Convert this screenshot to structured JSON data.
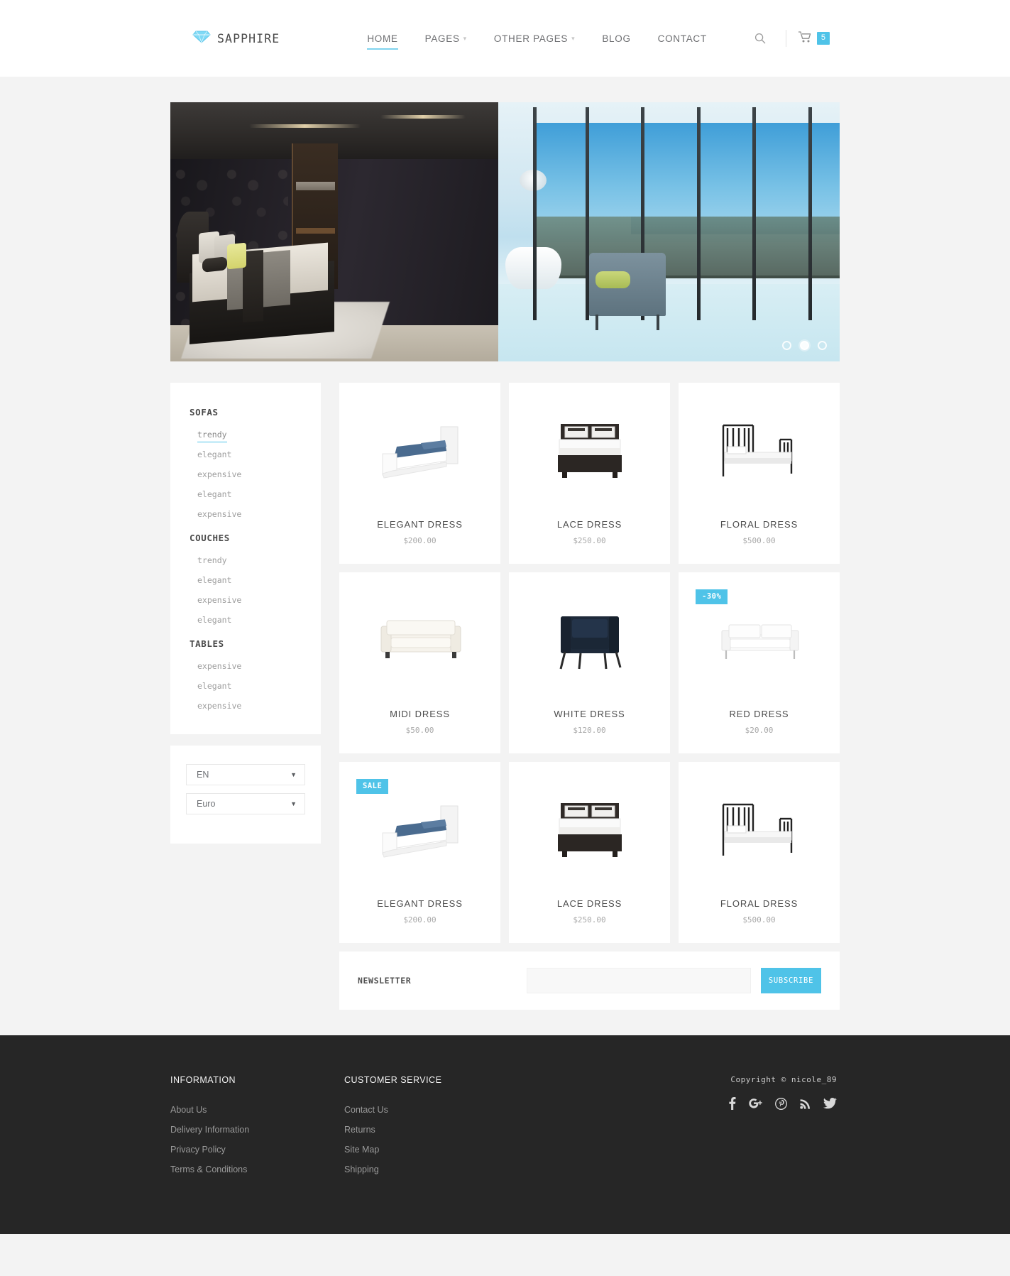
{
  "brand": {
    "name": "SAPPHIRE",
    "logo_icon": "diamond-icon",
    "accent": "#4fc3e8"
  },
  "nav": {
    "items": [
      {
        "label": "HOME",
        "active": true,
        "has_dropdown": false
      },
      {
        "label": "PAGES",
        "active": false,
        "has_dropdown": true
      },
      {
        "label": "OTHER PAGES",
        "active": false,
        "has_dropdown": true
      },
      {
        "label": "BLOG",
        "active": false,
        "has_dropdown": false
      },
      {
        "label": "CONTACT",
        "active": false,
        "has_dropdown": false
      }
    ]
  },
  "tools": {
    "search_icon": "search-icon",
    "cart_icon": "shopping-cart-icon",
    "cart_count": "5"
  },
  "hero": {
    "alt": "luxury bedroom with floor to ceiling windows and city view",
    "dots": [
      {
        "active": false
      },
      {
        "active": true
      },
      {
        "active": false
      }
    ]
  },
  "sidebar": {
    "groups": [
      {
        "title": "SOFAS",
        "links": [
          {
            "label": "trendy",
            "active": true
          },
          {
            "label": "elegant",
            "active": false
          },
          {
            "label": "expensive",
            "active": false
          },
          {
            "label": "elegant",
            "active": false
          },
          {
            "label": "expensive",
            "active": false
          }
        ]
      },
      {
        "title": "COUCHES",
        "links": [
          {
            "label": "trendy",
            "active": false
          },
          {
            "label": "elegant",
            "active": false
          },
          {
            "label": "expensive",
            "active": false
          },
          {
            "label": "elegant",
            "active": false
          }
        ]
      },
      {
        "title": "TABLES",
        "links": [
          {
            "label": "expensive",
            "active": false
          },
          {
            "label": "elegant",
            "active": false
          },
          {
            "label": "expensive",
            "active": false
          }
        ]
      }
    ],
    "selects": [
      {
        "name": "language-select",
        "value": "EN"
      },
      {
        "name": "currency-select",
        "value": "Euro"
      }
    ]
  },
  "products": [
    {
      "title": "ELEGANT DRESS",
      "price": "$200.00",
      "badge": null,
      "image": "white-single-bed-blue-bedding"
    },
    {
      "title": "LACE DRESS",
      "price": "$250.00",
      "badge": null,
      "image": "dark-double-bed-white-bedding"
    },
    {
      "title": "FLORAL DRESS",
      "price": "$500.00",
      "badge": null,
      "image": "black-metal-frame-bed"
    },
    {
      "title": "MIDI DRESS",
      "price": "$50.00",
      "badge": null,
      "image": "cream-white-sofa"
    },
    {
      "title": "WHITE DRESS",
      "price": "$120.00",
      "badge": null,
      "image": "navy-armchair"
    },
    {
      "title": "RED DRESS",
      "price": "$20.00",
      "badge": "-30%",
      "image": "white-leather-loveseat"
    },
    {
      "title": "ELEGANT DRESS",
      "price": "$200.00",
      "badge": "SALE",
      "image": "white-single-bed-blue-bedding"
    },
    {
      "title": "LACE DRESS",
      "price": "$250.00",
      "badge": null,
      "image": "dark-double-bed-white-bedding"
    },
    {
      "title": "FLORAL DRESS",
      "price": "$500.00",
      "badge": null,
      "image": "black-metal-frame-bed"
    }
  ],
  "newsletter": {
    "label": "NEWSLETTER",
    "input_value": "",
    "placeholder": "",
    "button": "SUBSCRIBE"
  },
  "footer": {
    "columns": [
      {
        "title": "INFORMATION",
        "links": [
          "About Us",
          "Delivery Information",
          "Privacy Policy",
          "Terms & Conditions"
        ]
      },
      {
        "title": "CUSTOMER SERVICE",
        "links": [
          "Contact Us",
          "Returns",
          "Site Map",
          "Shipping"
        ]
      }
    ],
    "copyright": "Copyright © nicole_89",
    "socials": [
      "facebook-icon",
      "google-plus-icon",
      "pinterest-icon",
      "rss-icon",
      "twitter-icon"
    ]
  }
}
